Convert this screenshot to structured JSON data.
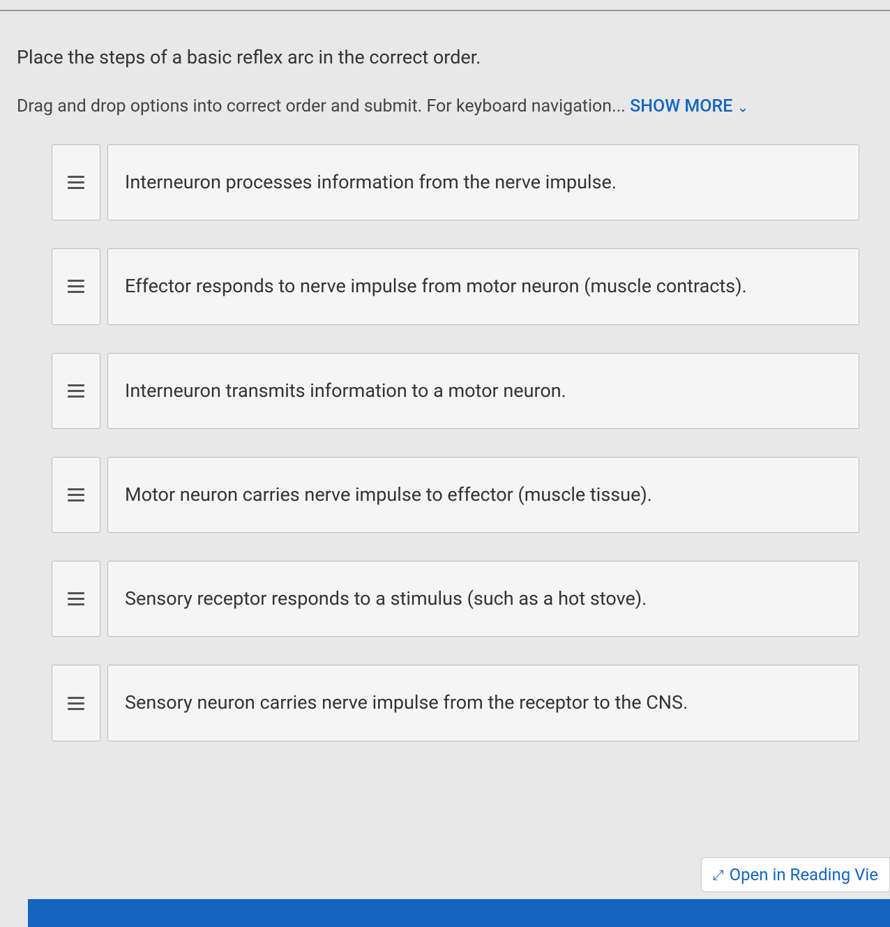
{
  "question": {
    "title": "Place the steps of a basic reflex arc in the correct order.",
    "instructions_prefix": "Drag and drop options into correct order and submit. For keyboard navigation... ",
    "show_more_label": "SHOW MORE"
  },
  "items": [
    {
      "text": "Interneuron processes information from the nerve impulse."
    },
    {
      "text": "Effector responds to nerve impulse from motor neuron (muscle contracts)."
    },
    {
      "text": "Interneuron transmits information to a motor neuron."
    },
    {
      "text": "Motor neuron carries nerve impulse to effector (muscle tissue)."
    },
    {
      "text": "Sensory receptor responds to a stimulus (such as a hot stove)."
    },
    {
      "text": "Sensory neuron carries nerve impulse from the receptor to the CNS."
    }
  ],
  "reading_view": {
    "label": "Open in Reading Vie"
  }
}
